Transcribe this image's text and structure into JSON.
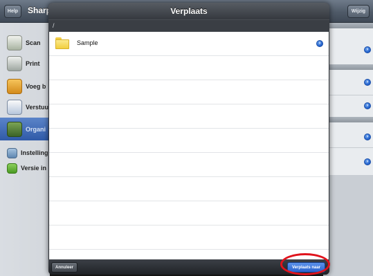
{
  "app": {
    "title": "Sharp",
    "help_label": "Help",
    "edit_label": "Wijzig"
  },
  "sidebar": {
    "items": [
      {
        "label": "Scan",
        "icon": "scan-icon"
      },
      {
        "label": "Print",
        "icon": "print-icon"
      },
      {
        "label": "Voeg b",
        "icon": "attach-icon"
      },
      {
        "label": "Verstuu",
        "icon": "send-icon"
      },
      {
        "label": "Organi",
        "icon": "organize-icon",
        "selected": true
      },
      {
        "label": "Instelling",
        "icon": "settings-icon"
      },
      {
        "label": "Versie in",
        "icon": "info-icon"
      }
    ]
  },
  "modal": {
    "title": "Verplaats",
    "path": "/",
    "rows": [
      {
        "label": "Sample",
        "type": "folder",
        "has_detail": true
      }
    ],
    "cancel_label": "Annuleer",
    "move_label": "Verplaats naar"
  },
  "colors": {
    "accent": "#2a62cf",
    "highlight": "#e0131c",
    "selected_row": "#2f5aa8"
  }
}
